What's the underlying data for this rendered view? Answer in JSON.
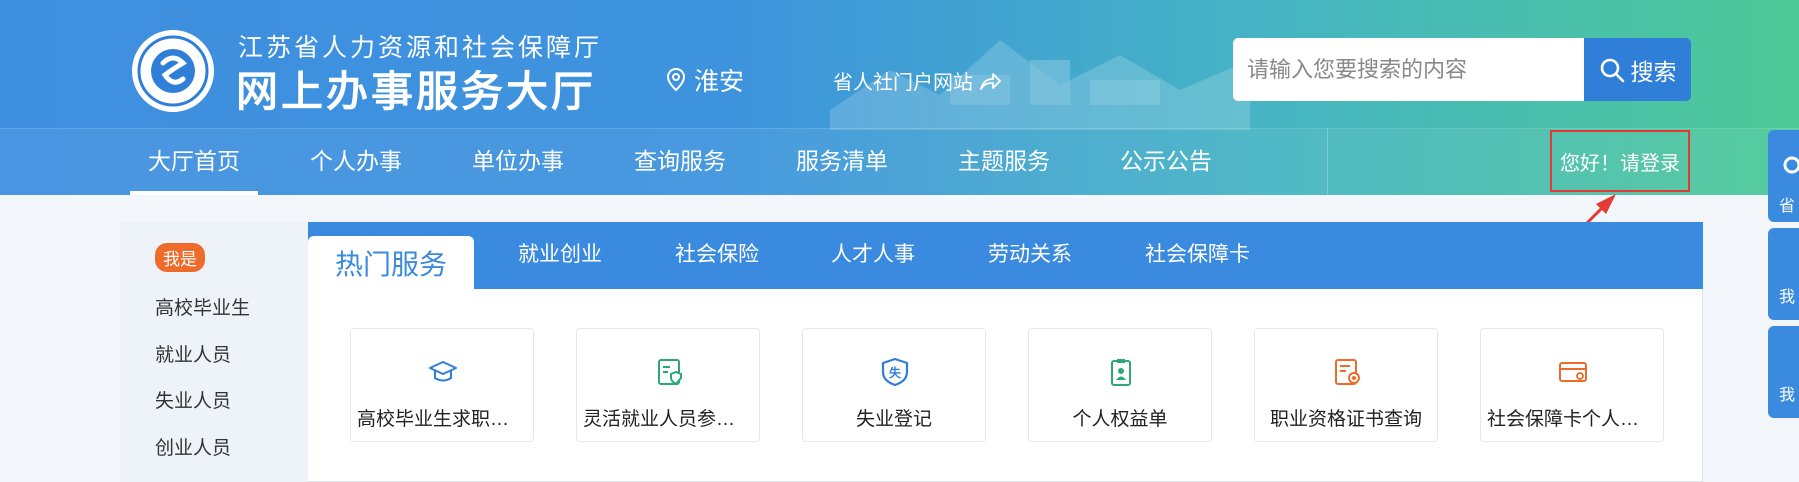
{
  "header": {
    "title_top": "江苏省人力资源和社会保障厅",
    "title_main": "网上办事服务大厅",
    "location": "淮安",
    "portal_link": "省人社门户网站",
    "search": {
      "placeholder": "请输入您要搜索的内容",
      "button_label": "搜索"
    },
    "login": "您好！请登录",
    "nav": [
      "大厅首页",
      "个人办事",
      "单位办事",
      "查询服务",
      "服务清单",
      "主题服务",
      "公示公告"
    ],
    "nav_active": "大厅首页"
  },
  "sidebar": {
    "badge": "我是",
    "items": [
      "高校毕业生",
      "就业人员",
      "失业人员",
      "创业人员"
    ]
  },
  "tabs": {
    "active": "热门服务",
    "items": [
      "就业创业",
      "社会保险",
      "人才人事",
      "劳动关系",
      "社会保障卡"
    ]
  },
  "services": [
    {
      "label": "高校毕业生求职登记",
      "icon": "graduation-cap-icon",
      "color": "#2f7fd9"
    },
    {
      "label": "灵活就业人员参保…",
      "icon": "id-card-shield-icon",
      "color": "#2aa876"
    },
    {
      "label": "失业登记",
      "icon": "unemployment-shield-icon",
      "color": "#2f7fd9"
    },
    {
      "label": "个人权益单",
      "icon": "clipboard-person-icon",
      "color": "#2aa876"
    },
    {
      "label": "职业资格证书查询",
      "icon": "certificate-icon",
      "color": "#ee6b2c"
    },
    {
      "label": "社会保障卡个人首…",
      "icon": "bank-card-icon",
      "color": "#ee6b2c"
    }
  ],
  "float": {
    "item1": "省",
    "item2": "我",
    "item3": "我"
  },
  "colors": {
    "primary": "#3a8ae0",
    "accent": "#ee6b2c",
    "annotation": "#e53935"
  }
}
